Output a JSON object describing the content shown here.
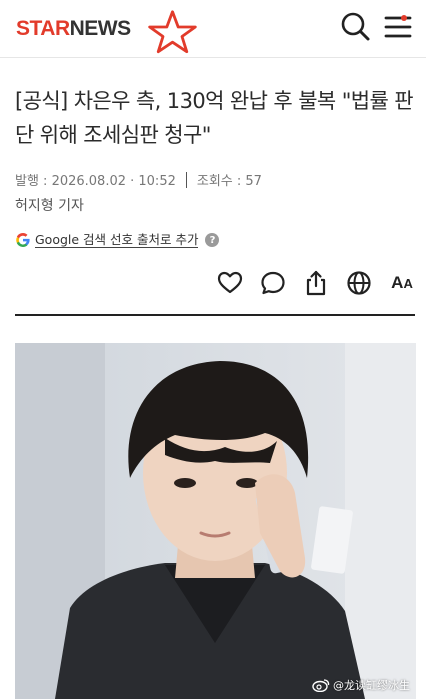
{
  "header": {
    "logo_star": "STAR",
    "logo_news": "NEWS",
    "brand_color": "#e23b2b",
    "icons": [
      "search-icon",
      "menu-icon"
    ]
  },
  "article": {
    "title": "[공식] 차은우 측, 130억 완납 후 불복 \"법률 판단 위해 조세심판 청구\"",
    "published": "발행 : 2026.08.02 · 10:52",
    "views": "조회수 : 57",
    "author": "허지형 기자",
    "google_link": "Google 검색 선호 출처로 추가",
    "help": "?"
  },
  "actions": {
    "icons": [
      "heart-icon",
      "comment-icon",
      "share-icon",
      "globe-icon",
      "font-size-icon"
    ],
    "font_big": "A",
    "font_small": "A"
  },
  "photo": {
    "watermark": "@龙读缸缪冰生"
  }
}
